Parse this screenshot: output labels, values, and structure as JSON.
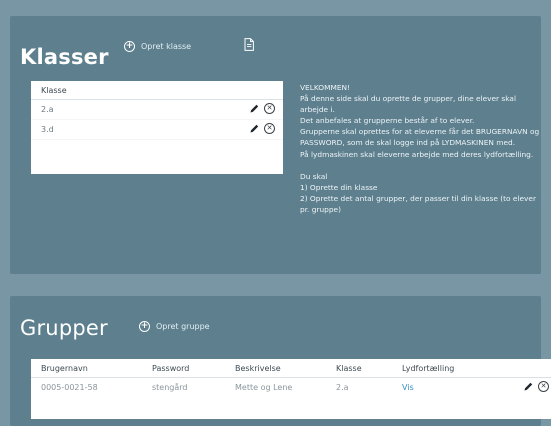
{
  "klasser": {
    "title": "Klasser",
    "opret_label": "Opret klasse",
    "table": {
      "header": "Klasse",
      "rows": [
        "2.a",
        "3.d"
      ]
    }
  },
  "welcome": {
    "lines": [
      "VELKOMMEN!",
      "På denne side skal du oprette de grupper, dine elever skal arbejde i.",
      "Det anbefales at grupperne består af to elever.",
      "Grupperne skal oprettes for at eleverne får det BRUGERNAVN og PASSWORD, som de skal logge ind på LYDMASKINEN med.",
      "På lydmaskinen skal eleverne arbejde med deres lydfortælling.",
      "",
      "Du skal",
      "1) Oprette din klasse",
      "2) Oprette det antal grupper, der passer til din klasse (to elever pr. gruppe)"
    ]
  },
  "grupper": {
    "title": "Grupper",
    "opret_label": "Opret gruppe",
    "columns": [
      "Brugernavn",
      "Password",
      "Beskrivelse",
      "Klasse",
      "Lydfortælling"
    ],
    "rows": [
      {
        "brugernavn": "0005-0021-58",
        "password": "stengård",
        "beskrivelse": "Mette og Lene",
        "klasse": "2.a",
        "lydfortaelling": "Vis"
      }
    ]
  },
  "colors": {
    "background": "#7896a4",
    "panel": "#5d7f8e",
    "link": "#3a8fc5"
  },
  "icons": {
    "add": "plus-circle-icon",
    "document": "document-icon",
    "edit": "pencil-icon",
    "delete": "x-circle-icon"
  }
}
